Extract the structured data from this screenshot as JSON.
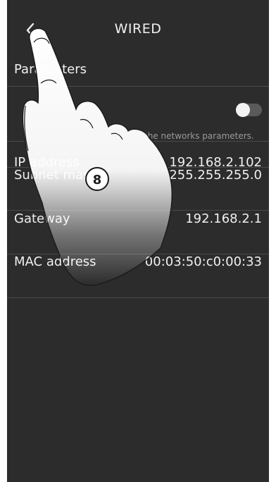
{
  "header": {
    "title": "WIRED",
    "back_icon": "chevron-left-icon"
  },
  "parameters": {
    "section_label": "Parameters",
    "dhcp_toggle_on": false,
    "toggle_description": "the networks parameters."
  },
  "network": {
    "rows": [
      {
        "label": "IP address",
        "value": "192.168.2.102"
      },
      {
        "label": "Subnet mask",
        "value": "255.255.255.0"
      },
      {
        "label": "Gateway",
        "value": "192.168.2.1"
      },
      {
        "label": "MAC address",
        "value": "00:03:50:c0:00:33"
      }
    ]
  },
  "annotation": {
    "step_number": "8"
  },
  "colors": {
    "background": "#2c2c2c",
    "text": "#f0f0f0",
    "muted_text": "#9a9a9a",
    "divider": "#4a4a4a"
  }
}
